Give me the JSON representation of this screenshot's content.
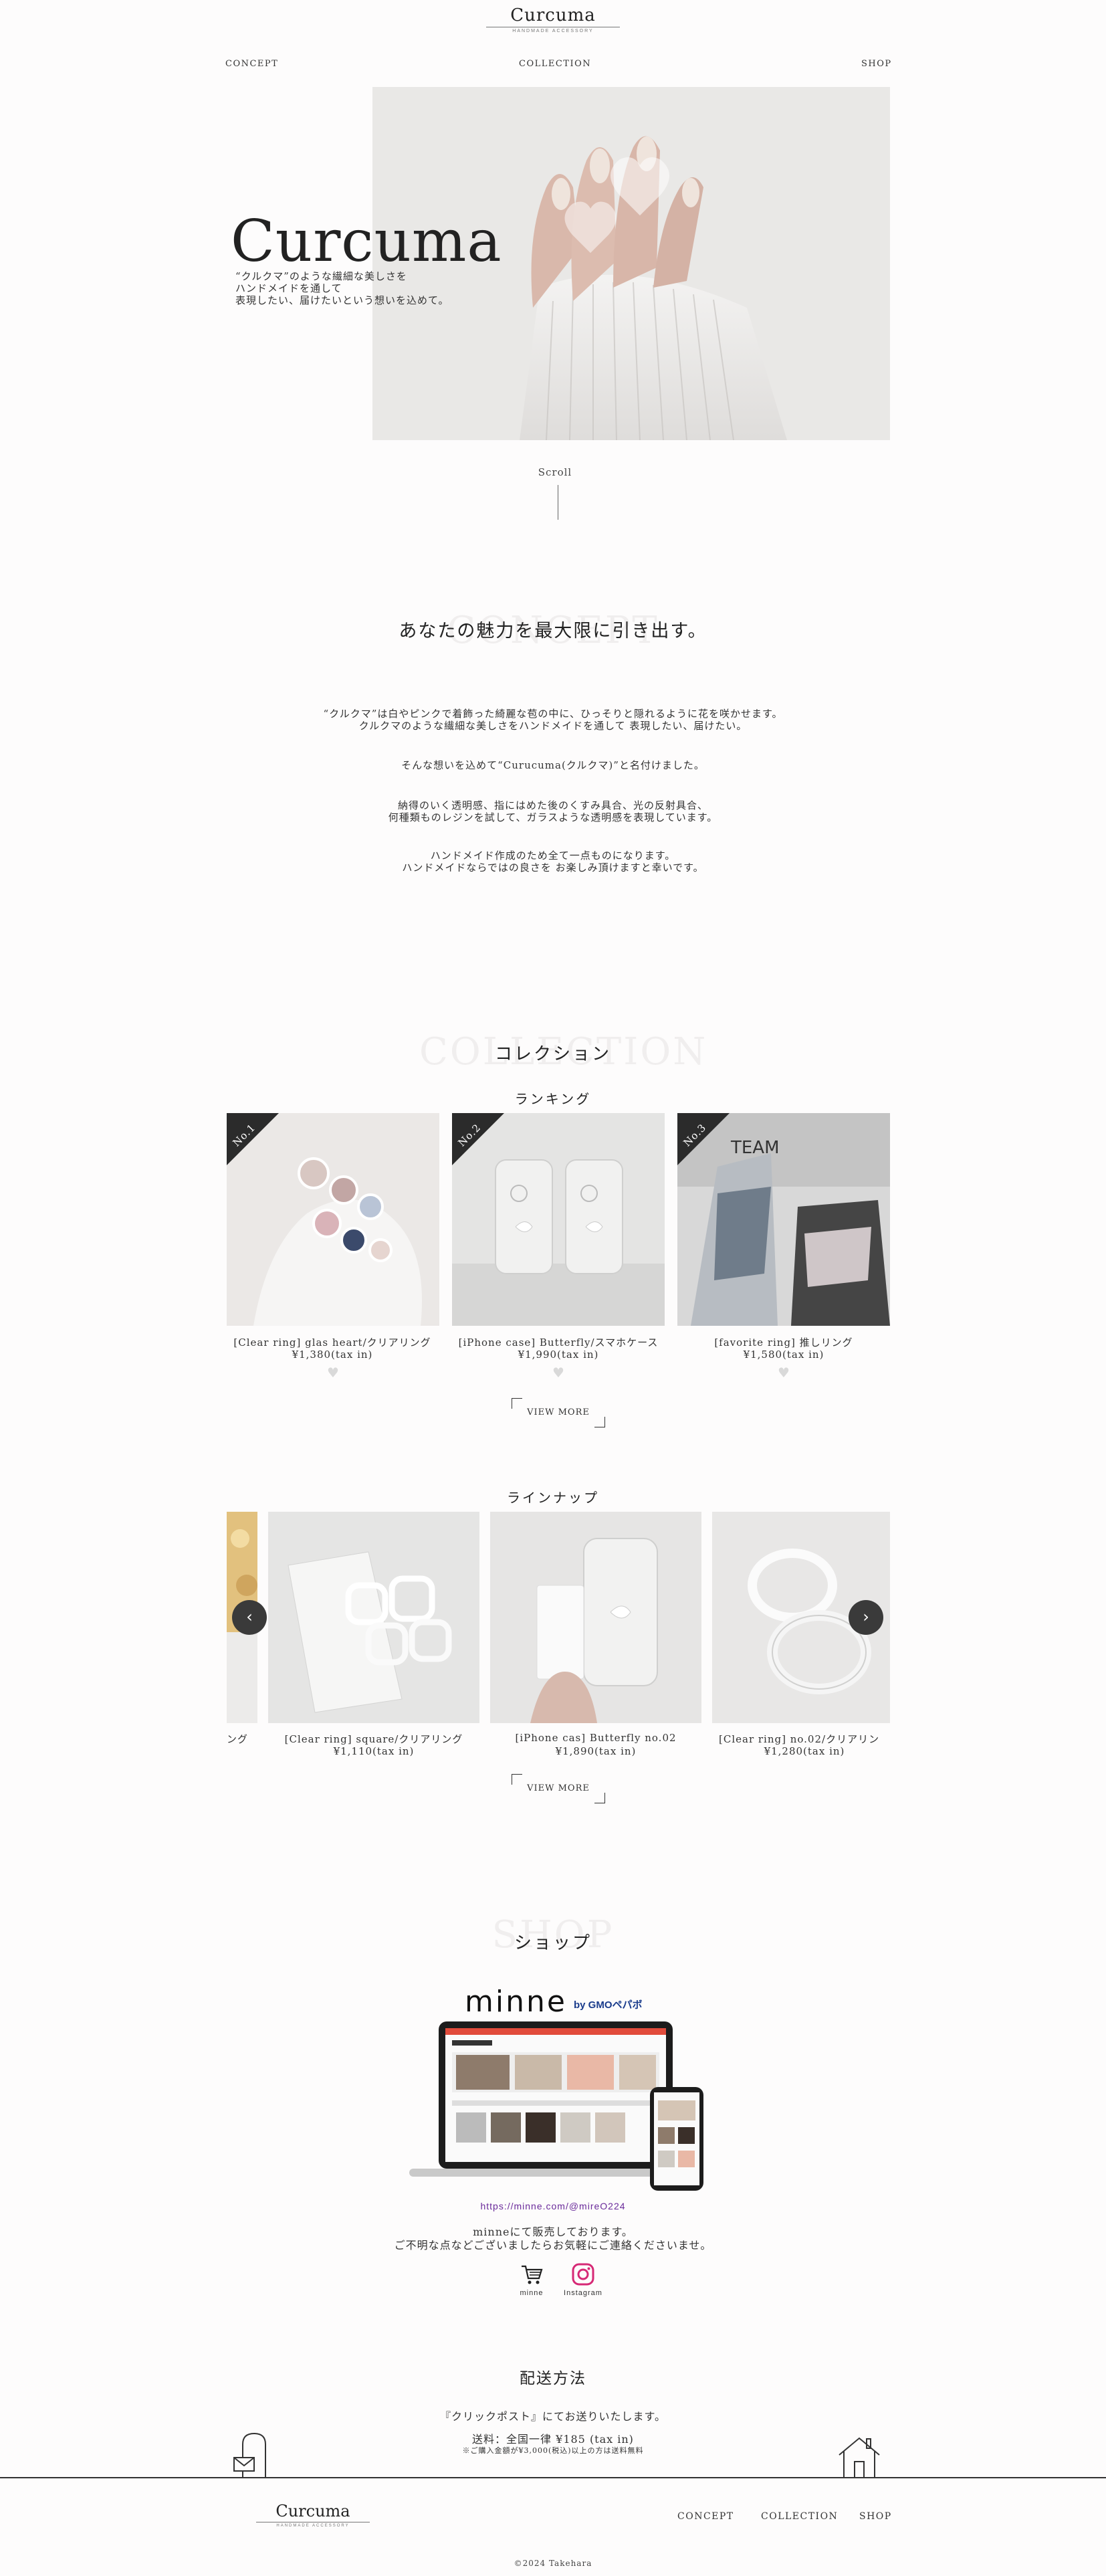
{
  "header": {
    "logo_name": "Curcuma",
    "logo_sub": "HANDMADE ACCESSORY",
    "nav": [
      "CONCEPT",
      "COLLECTION",
      "SHOP"
    ]
  },
  "hero": {
    "title": "Curcuma",
    "copy_lines": [
      "“クルクマ”のような繊細な美しさを",
      "ハンドメイドを通して",
      "表現したい、届けたいという想いを込めて。"
    ],
    "scroll_label": "Scroll"
  },
  "concept": {
    "ghost": "CONCEPT",
    "heading": "あなたの魅力を最大限に引き出す。",
    "paragraphs": [
      [
        "“クルクマ”は白やピンクで着飾った綺麗な苞の中に、ひっそりと隠れるように花を咲かせます。",
        "クルクマのような繊細な美しさをハンドメイドを通して 表現したい、届けたい。"
      ],
      [
        "そんな想いを込めて“Curucuma(クルクマ)”と名付けました。"
      ],
      [
        "納得のいく透明感、指にはめた後のくすみ具合、光の反射具合、",
        "何種類ものレジンを試して、ガラスような透明感を表現しています。"
      ],
      [
        "ハンドメイド作成のため全て一点ものになります。",
        "ハンドメイドならではの良さを お楽しみ頂けますと幸いです。"
      ]
    ]
  },
  "collection": {
    "ghost": "COLLECTION",
    "heading": "コレクション",
    "ranking_heading": "ランキング",
    "ranking": [
      {
        "rank": "No.1",
        "title": "[Clear ring] glas heart/クリアリング",
        "price": "¥1,380(tax in)"
      },
      {
        "rank": "No.2",
        "title": "[iPhone case] Butterfly/スマホケース",
        "price": "¥1,990(tax in)"
      },
      {
        "rank": "No.3",
        "title": "[favorite ring] 推しリング",
        "price": "¥1,580(tax in)"
      }
    ],
    "view_more": "VIEW MORE",
    "lineup_heading": "ラインナップ",
    "lineup_partial_title": "ング",
    "lineup": [
      {
        "title": "[Clear ring] square/クリアリング",
        "price": "¥1,110(tax in)"
      },
      {
        "title": "[iPhone cas] Butterfly no.02",
        "price": "¥1,890(tax in)"
      },
      {
        "title": "[Clear ring] no.02/クリアリン",
        "price": "¥1,280(tax in)"
      }
    ],
    "prev_icon": "chevron-left-icon",
    "next_icon": "chevron-right-icon"
  },
  "shop": {
    "ghost": "SHOP",
    "heading": "ショップ",
    "minne_logo": "minne",
    "minne_by": "by GMOペパボ",
    "url": "https://minne.com/@mireO224",
    "text_lines": [
      "minneにて販売しております。",
      "ご不明な点などございましたらお気軽にご連絡くださいませ。"
    ],
    "links": [
      {
        "label": "minne",
        "icon": "cart-icon"
      },
      {
        "label": "Instagram",
        "icon": "instagram-icon"
      }
    ]
  },
  "shipping": {
    "heading": "配送方法",
    "lines": [
      "『クリックポスト』にてお送りいたします。",
      "送料：全国一律 ¥185 (tax in)"
    ],
    "note": "※ご購入金額が¥3,000(税込)以上の方は送料無料"
  },
  "footer": {
    "logo_name": "Curcuma",
    "logo_sub": "HANDMADE ACCESSORY",
    "nav": [
      "CONCEPT",
      "COLLECTION",
      "SHOP"
    ],
    "copyright": "©2024 Takehara"
  },
  "colors": {
    "background": "#fdfcfc",
    "text": "#333333",
    "ribbon": "#2b2b2b",
    "url": "#6a2a9a",
    "instagram": "#d62976"
  }
}
